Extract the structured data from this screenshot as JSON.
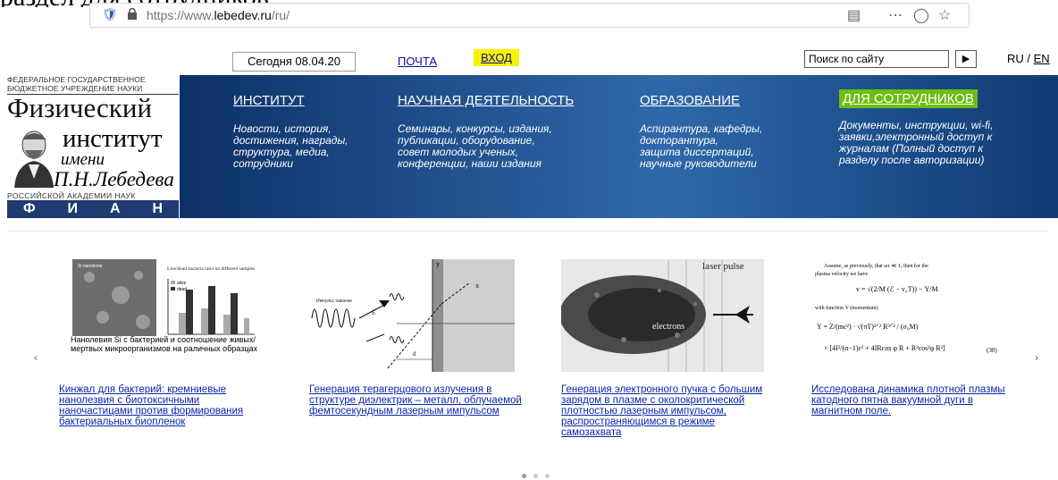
{
  "header_handwriting": "раздел для сотрудников",
  "browser": {
    "url_prefix": "https://www.",
    "url_domain": "lebedev.ru",
    "url_suffix": "/ru/"
  },
  "topbar": {
    "date": "Сегодня 08.04.20",
    "mail": "ПОЧТА",
    "login": "ВХОД",
    "search_placeholder": "Поиск по сайту",
    "lang_ru": "RU",
    "lang_sep": " / ",
    "lang_en": "EN"
  },
  "logo": {
    "top_line1": "ФЕДЕРАЛЬНОЕ ГОСУДАРСТВЕННОЕ",
    "top_line2": "БЮДЖЕТНОЕ  УЧРЕЖДЕНИЕ НАУКИ",
    "title": "Физический",
    "institute": "институт",
    "imeni": "имени",
    "name": "П.Н.Лебедева",
    "ran": "РОССИЙСКОЙ АКАДЕМИИ НАУК",
    "fian": [
      "Ф",
      "И",
      "А",
      "Н"
    ]
  },
  "banner": [
    {
      "title": "ИНСТИТУТ",
      "desc": [
        "Новости, история,",
        "достижения, награды,",
        "структура, медиа,",
        "сотрудники"
      ]
    },
    {
      "title": "НАУЧНАЯ ДЕЯТЕЛЬНОСТЬ",
      "desc": [
        "Семинары, конкурсы, издания,",
        "публикации, оборудование,",
        "совет молодых ученых,",
        "конференции, наши издания"
      ]
    },
    {
      "title": "ОБРАЗОВАНИЕ",
      "desc": [
        "Аспирантура, кафедры,",
        "докторантура,",
        "защита диссертаций,",
        "научные руководители"
      ]
    },
    {
      "title": "ДЛЯ СОТРУДНИКОВ",
      "desc": [
        "Документы, инструкции, wi-fi,",
        "заявки,электронный доступ к",
        "журналам (Полный доступ к",
        "разделу после авторизации)"
      ]
    }
  ],
  "cards": [
    {
      "caption": "Нанолевия Si с бактерией и соотношение живых/мертвых микроорганизмов на раличных образцах",
      "chart_title": "Live/dead bacteria ratio on different samples",
      "chart_legend": [
        "alive",
        "dead"
      ],
      "link": "Кинжал для бактерий: кремниевые нанолезвия с биотоксичными наночастицами против формирования бактериальных биопленок"
    },
    {
      "label": "Импульс накачки",
      "link": "Генерация терагерцового излучения в структуре диэлектрик – металл, облучаемой фемтосекундным лазерным импульсом"
    },
    {
      "label_top": "laser pulse",
      "label_mid": "electrons",
      "link": "Генерация электронного пучка с большим зарядом в плазме с околокритической плотностью лазерным импульсом, распространяющимся в режиме самозахвата"
    },
    {
      "text_line1": "Assume, as previously, that ωτ ≪ 1; then for the",
      "text_line2": "plasma velocity we have",
      "text_line3": "with function Υ (momentum)",
      "eq_num": "(30)",
      "link": "Исследована динамика плотной плазмы катодного пятна вакуумной дуги в магнитном поле."
    }
  ],
  "carousel": {
    "prev": "‹",
    "next": "›"
  }
}
